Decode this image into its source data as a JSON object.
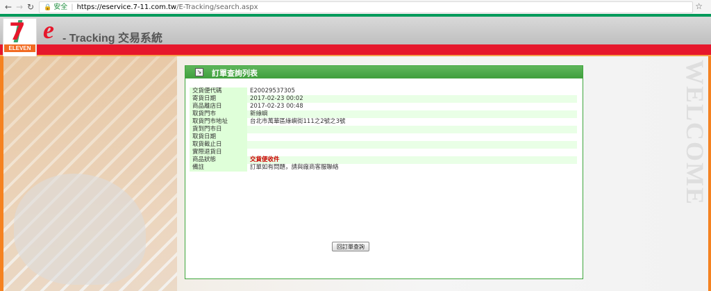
{
  "browser": {
    "secure_label": "安全",
    "url_host": "https://eservice.7-11.com.tw",
    "url_path": "/E-Tracking/search.aspx"
  },
  "header": {
    "logo_text": "ELEVEN",
    "brand_e": "e",
    "brand_title": "- Tracking 交易系統"
  },
  "background": {
    "watermark": "WELCOME"
  },
  "panel": {
    "title": "訂單查詢列表",
    "rows": [
      {
        "label": "交貨便代碼",
        "value": "E20029537305"
      },
      {
        "label": "寄貨日期",
        "value": "2017-02-23 00:02"
      },
      {
        "label": "商品離店日",
        "value": "2017-02-23 00:48"
      },
      {
        "label": "取貨門市",
        "value": "新綠嶼"
      },
      {
        "label": "取貨門市地址",
        "value": "台北市萬華區綠嶼街111之2號之3號"
      },
      {
        "label": "貨到門市日",
        "value": ""
      },
      {
        "label": "取貨日期",
        "value": ""
      },
      {
        "label": "取貨截止日",
        "value": ""
      },
      {
        "label": "實際退貨日",
        "value": ""
      },
      {
        "label": "商品狀態",
        "value": "交貨便收件"
      },
      {
        "label": "備註",
        "value": "訂單如有問題，請與廠商客服聯絡"
      }
    ],
    "back_button": "回訂單查詢"
  }
}
